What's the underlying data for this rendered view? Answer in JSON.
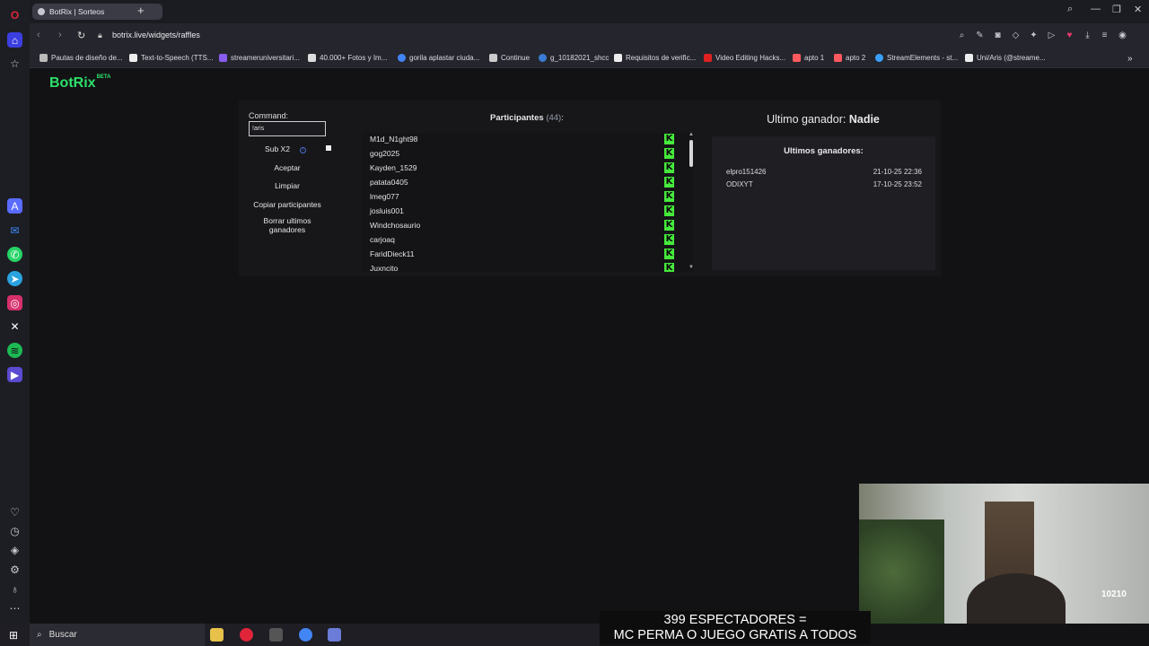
{
  "browser": {
    "tab_title": "BotRix | Sorteos",
    "url": "botrix.live/widgets/raffles",
    "bookmarks": [
      "Pautas de diseño de...",
      "Text-to-Speech (TTS...",
      "streameruniversitari...",
      "40.000+ Fotos y Im...",
      "gorila aplastar ciuda...",
      "Continue",
      "g_10182021_shcc",
      "Requisitos de verific...",
      "Video Editing Hacks...",
      "apto 1",
      "apto 2",
      "StreamElements - st...",
      "Uni/Aris (@streame..."
    ]
  },
  "logo": {
    "name": "BotRix",
    "badge": "BETA"
  },
  "raffle": {
    "command_label": "Command:",
    "command_value": "!aris",
    "sub_label": "Sub X2",
    "accept_label": "Aceptar",
    "clear_label": "Limpiar",
    "copy_label": "Copiar participantes",
    "delete_label": "Borrar ultimos ganadores",
    "participants_label": "Participantes",
    "participants_count": "(44)",
    "participants_colon": ":",
    "participants": [
      "M1d_N1ght98",
      "gog2025",
      "Kayden_1529",
      "patata0405",
      "lmeg077",
      "josluis001",
      "Windchosaurio",
      "carjoaq",
      "FaridDieck11",
      "Juxncito"
    ],
    "kick_glyph": "K",
    "winner_label": "Ultimo ganador:",
    "winner_name": "Nadie",
    "last_winners_title": "Ultimos ganadores:",
    "last_winners": [
      {
        "name": "elpro151426",
        "date": "21-10-25 22:36"
      },
      {
        "name": "ODIXYT",
        "date": "17-10-25 23:52"
      }
    ]
  },
  "overlay": {
    "ticker_line1": "399 ESPECTADORES =",
    "ticker_line2": "MC PERMA O JUEGO GRATIS A TODOS",
    "webcam_tag": "10210"
  },
  "taskbar": {
    "search_placeholder": "Buscar"
  },
  "colors": {
    "accent": "#2de06a",
    "kick": "#45e93b",
    "background": "#121214"
  }
}
